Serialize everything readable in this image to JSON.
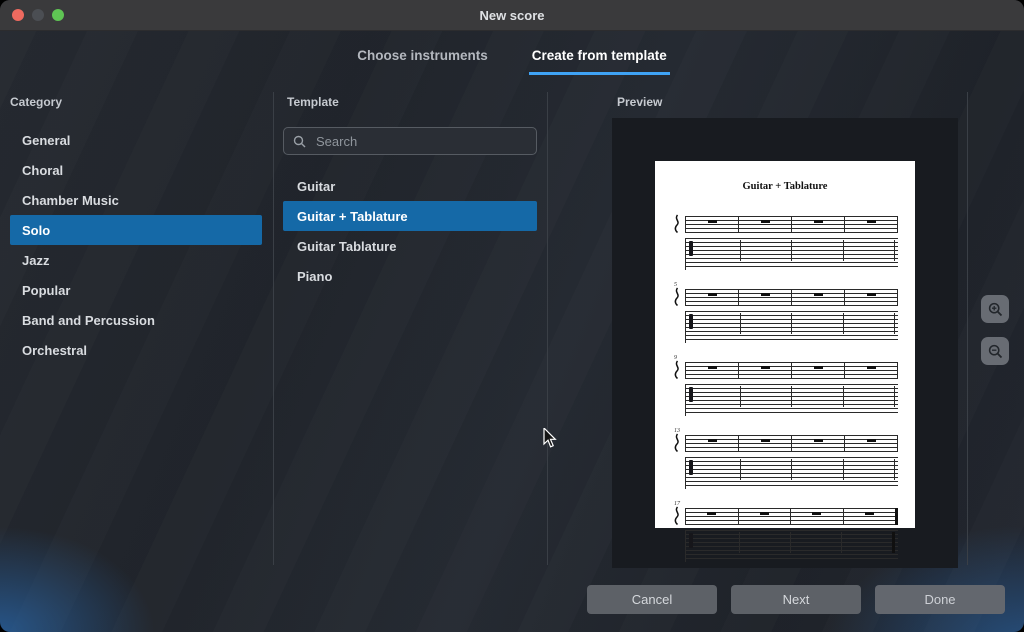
{
  "window": {
    "title": "New score"
  },
  "tabs": [
    {
      "label": "Choose instruments",
      "active": false
    },
    {
      "label": "Create from template",
      "active": true
    }
  ],
  "category": {
    "header": "Category",
    "items": [
      {
        "label": "General"
      },
      {
        "label": "Choral"
      },
      {
        "label": "Chamber Music"
      },
      {
        "label": "Solo",
        "selected": true
      },
      {
        "label": "Jazz"
      },
      {
        "label": "Popular"
      },
      {
        "label": "Band and Percussion"
      },
      {
        "label": "Orchestral"
      }
    ]
  },
  "template": {
    "header": "Template",
    "search_placeholder": "Search",
    "items": [
      {
        "label": "Guitar"
      },
      {
        "label": "Guitar + Tablature",
        "selected": true
      },
      {
        "label": "Guitar Tablature"
      },
      {
        "label": "Piano"
      }
    ]
  },
  "preview": {
    "header": "Preview",
    "page_title": "Guitar + Tablature",
    "systems": [
      {
        "number": ""
      },
      {
        "number": "5"
      },
      {
        "number": "9"
      },
      {
        "number": "13"
      },
      {
        "number": "17"
      }
    ]
  },
  "footer": {
    "buttons": [
      {
        "label": "Cancel"
      },
      {
        "label": "Next"
      },
      {
        "label": "Done"
      }
    ]
  },
  "colors": {
    "accent": "#3fa3f5",
    "selection": "#1569a7"
  }
}
